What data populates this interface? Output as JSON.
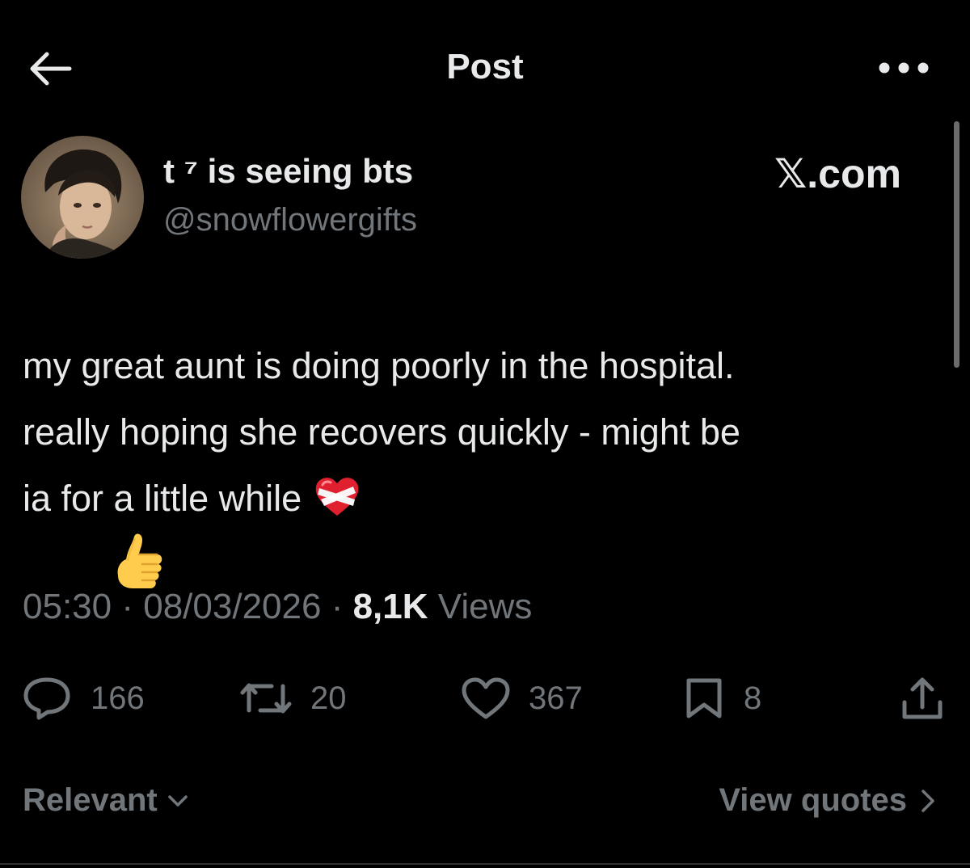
{
  "header": {
    "title": "Post",
    "back_icon": "arrow-left-icon",
    "more_icon": "more-horizontal-icon"
  },
  "author": {
    "display_name": "t ⁷ is seeing bts",
    "handle": "@snowflowergifts",
    "avatar_icon": "avatar-photo"
  },
  "brand": "𝕏.com",
  "post": {
    "lines": [
      "my great aunt is doing poorly in the hospital.",
      "really hoping she recovers quickly - might be",
      "ia for a little while"
    ],
    "emoji": "mending-heart-emoji",
    "reaction_emoji": "thumbs-up-emoji"
  },
  "meta": {
    "time": "05:30",
    "separator": "·",
    "date": "08/03/2026",
    "views_count": "8,1K",
    "views_label": "Views"
  },
  "actions": {
    "replies": "166",
    "reposts": "20",
    "likes": "367",
    "bookmarks": "8"
  },
  "footer": {
    "sort_label": "Relevant",
    "quotes_label": "View quotes"
  },
  "colors": {
    "background": "#000000",
    "primary_text": "#e7e9ea",
    "secondary_text": "#71767b"
  }
}
